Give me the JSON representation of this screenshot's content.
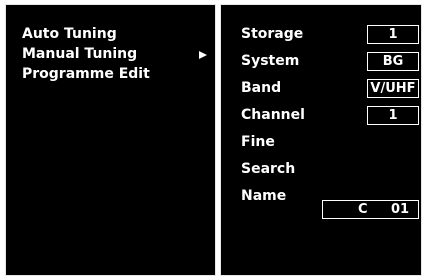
{
  "menu": {
    "items": [
      {
        "label": "Auto Tuning"
      },
      {
        "label": "Manual Tuning",
        "selected": true,
        "arrow_icon": "triangle-right-icon"
      },
      {
        "label": "Programme Edit"
      }
    ]
  },
  "settings": {
    "storage": {
      "label": "Storage",
      "value": "1"
    },
    "system": {
      "label": "System",
      "value": "BG"
    },
    "band": {
      "label": "Band",
      "value": "V/UHF"
    },
    "channel": {
      "label": "Channel",
      "value": "1"
    },
    "fine": {
      "label": "Fine"
    },
    "search": {
      "label": "Search"
    },
    "name": {
      "label": "Name",
      "value_prefix": "C",
      "value_number": "01"
    }
  },
  "colors": {
    "background": "#000000",
    "text": "#ffffff",
    "border": "#e6e6e6"
  }
}
